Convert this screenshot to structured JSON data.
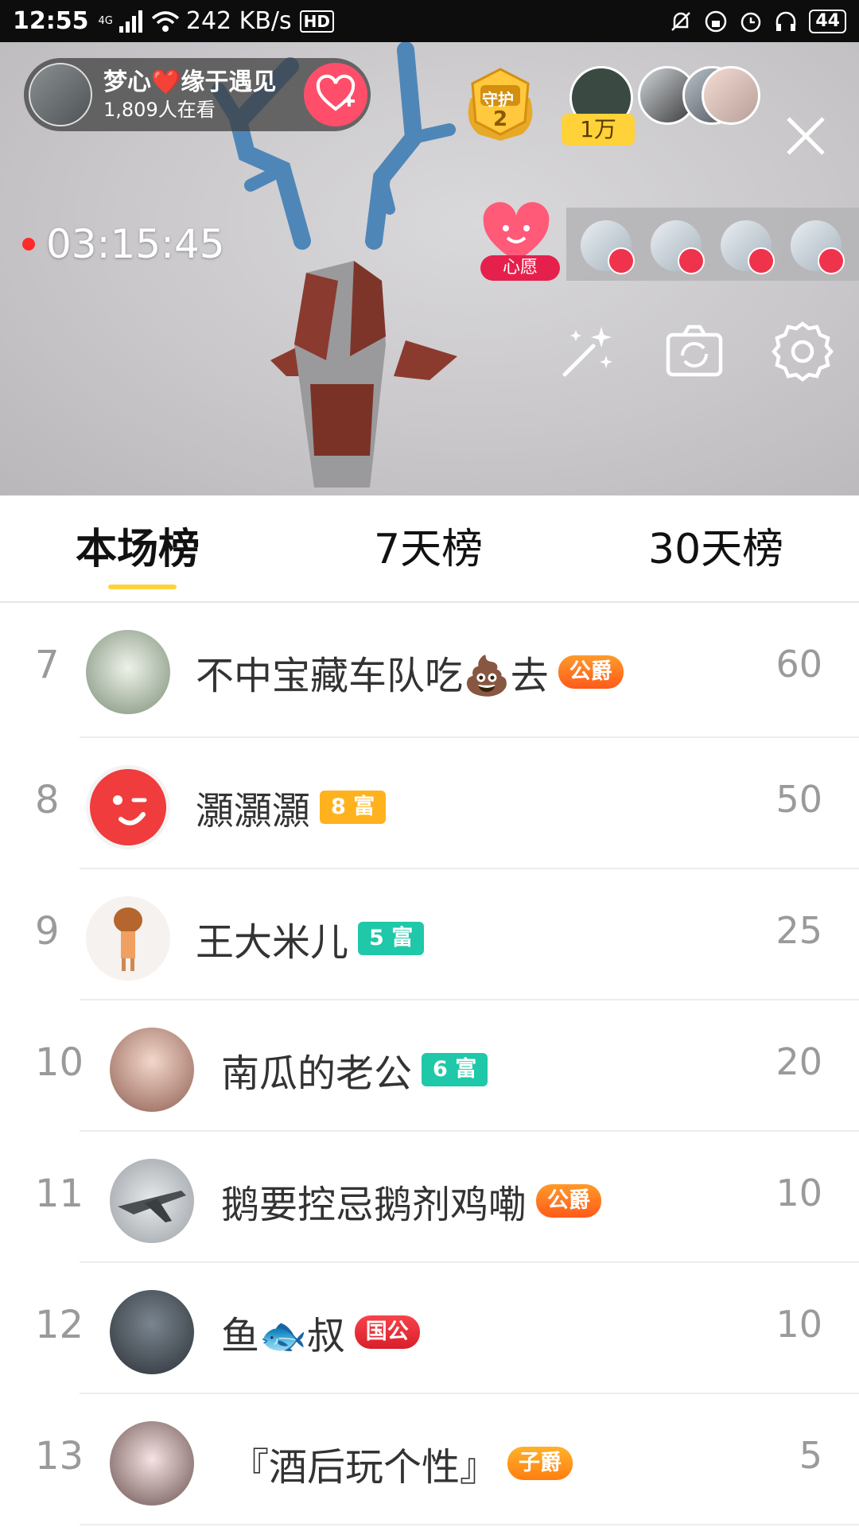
{
  "status_bar": {
    "time": "12:55",
    "network": "4G",
    "speed": "242 KB/s",
    "hd": "HD",
    "battery": "44"
  },
  "live": {
    "host_name": "梦心❤️缘于遇见",
    "viewers": "1,809人在看",
    "guard_label": "守护",
    "guard_count": "2",
    "fans_count": "1万",
    "duration": "03:15:45",
    "wish_label": "心愿",
    "icons": [
      "magic-wand-icon",
      "camera-flip-icon",
      "settings-icon",
      "close-icon"
    ]
  },
  "tabs": [
    {
      "label": "本场榜",
      "active": true
    },
    {
      "label": "7天榜",
      "active": false
    },
    {
      "label": "30天榜",
      "active": false
    }
  ],
  "ranking": [
    {
      "rank": "7",
      "name": "不中宝藏车队吃💩去",
      "badge": "公爵",
      "badge_type": "duke",
      "score": "60"
    },
    {
      "rank": "8",
      "name": "灝灝灝",
      "badge": "8 富",
      "badge_type": "rich8",
      "score": "50"
    },
    {
      "rank": "9",
      "name": "王大米儿",
      "badge": "5 富",
      "badge_type": "rich5",
      "score": "25"
    },
    {
      "rank": "10",
      "name": "南瓜的老公",
      "badge": "6 富",
      "badge_type": "rich6",
      "score": "20"
    },
    {
      "rank": "11",
      "name": "鹅要控忌鹅剂鸡嘞",
      "badge": "公爵",
      "badge_type": "duke",
      "score": "10"
    },
    {
      "rank": "12",
      "name": "鱼🐟叔",
      "badge": "国公",
      "badge_type": "guogong",
      "score": "10"
    },
    {
      "rank": "13",
      "name": "『酒后玩个性』",
      "badge": "子爵",
      "badge_type": "zijue",
      "score": "5"
    }
  ],
  "colors": {
    "accent_yellow": "#ffd23a",
    "follow_pink": "#ff4e6a",
    "rank_gray": "#9a9a9a"
  }
}
